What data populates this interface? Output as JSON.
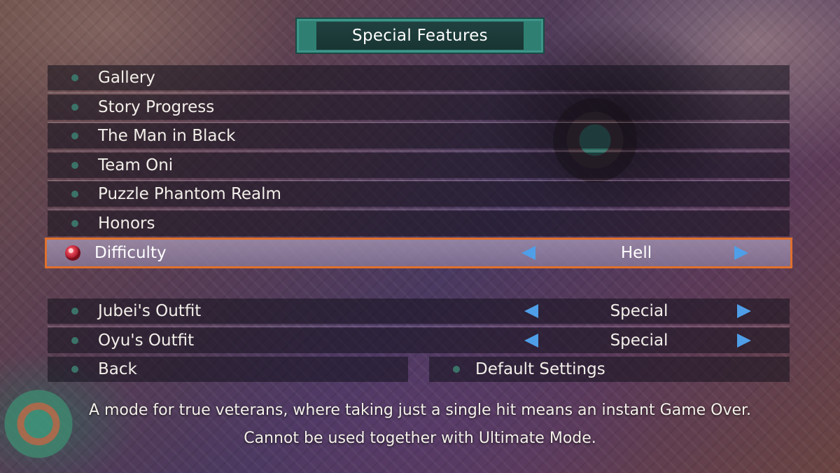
{
  "header": {
    "title": "Special Features"
  },
  "menu": {
    "items": [
      {
        "label": "Gallery"
      },
      {
        "label": "Story Progress"
      },
      {
        "label": "The Man in Black"
      },
      {
        "label": "Team Oni"
      },
      {
        "label": "Puzzle Phantom Realm"
      },
      {
        "label": "Honors"
      },
      {
        "label": "Difficulty",
        "value": "Hell",
        "selected": true
      }
    ],
    "options": [
      {
        "label": "Jubei's Outfit",
        "value": "Special"
      },
      {
        "label": "Oyu's Outfit",
        "value": "Special"
      }
    ],
    "back_label": "Back",
    "default_label": "Default Settings"
  },
  "description": {
    "line1": "A mode for true veterans, where taking just a single hit means an instant Game Over.",
    "line2": "Cannot be used together with Ultimate Mode."
  },
  "colors": {
    "accent_selected_border": "#e0702c",
    "arrow": "#4f9ee8",
    "bullet": "#3b7368",
    "header": "#2f7f72"
  },
  "icons": {
    "bullet": "dot-icon",
    "selected_bullet": "red-orb-icon",
    "left": "arrow-left-icon",
    "right": "arrow-right-icon"
  }
}
